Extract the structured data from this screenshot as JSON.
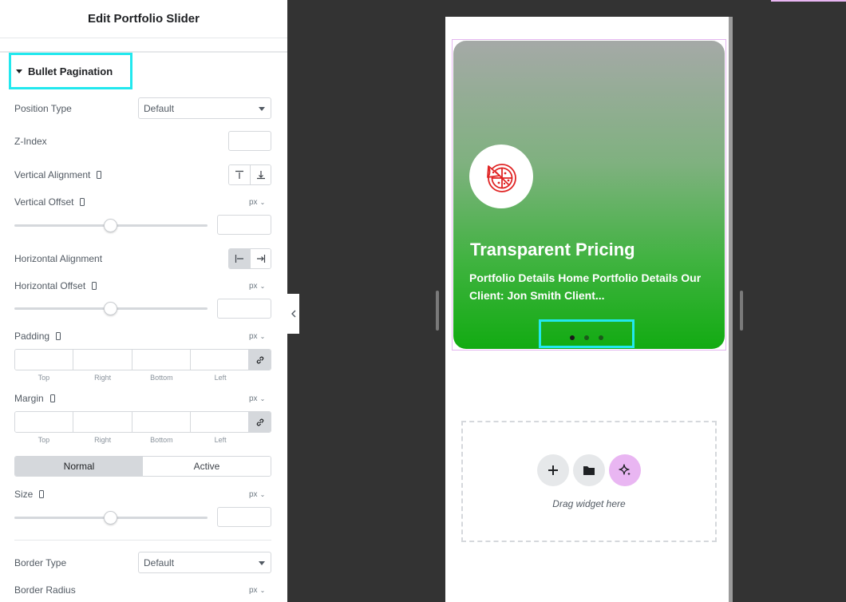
{
  "panel": {
    "title": "Edit Portfolio Slider",
    "section_title": "Bullet Pagination",
    "controls": {
      "position_type": {
        "label": "Position Type",
        "value": "Default"
      },
      "z_index": {
        "label": "Z-Index"
      },
      "vertical_alignment": {
        "label": "Vertical Alignment"
      },
      "vertical_offset": {
        "label": "Vertical Offset",
        "unit": "px"
      },
      "horizontal_alignment": {
        "label": "Horizontal Alignment"
      },
      "horizontal_offset": {
        "label": "Horizontal Offset",
        "unit": "px"
      },
      "padding": {
        "label": "Padding",
        "unit": "px"
      },
      "margin": {
        "label": "Margin",
        "unit": "px"
      },
      "size": {
        "label": "Size",
        "unit": "px"
      },
      "border_type": {
        "label": "Border Type",
        "value": "Default"
      },
      "border_radius": {
        "label": "Border Radius",
        "unit": "px"
      }
    },
    "dims_labels": {
      "top": "Top",
      "right": "Right",
      "bottom": "Bottom",
      "left": "Left"
    },
    "tabs": {
      "normal": "Normal",
      "active": "Active"
    }
  },
  "preview": {
    "card": {
      "title": "Transparent Pricing",
      "excerpt": "Portfolio Details Home Portfolio Details Our Client: Jon Smith Client..."
    },
    "drop_zone": {
      "hint": "Drag widget here"
    }
  },
  "icons": {
    "slider_card": "pizza-icon",
    "add": "plus-icon",
    "template": "folder-icon",
    "ai": "sparkle-icon"
  },
  "colors": {
    "highlight": "#22e8ee",
    "card_gradient_top": "#a5a9a7",
    "card_gradient_bottom": "#12ab12",
    "pizza_red": "#e02424",
    "ai_button": "#e9b6f2"
  }
}
